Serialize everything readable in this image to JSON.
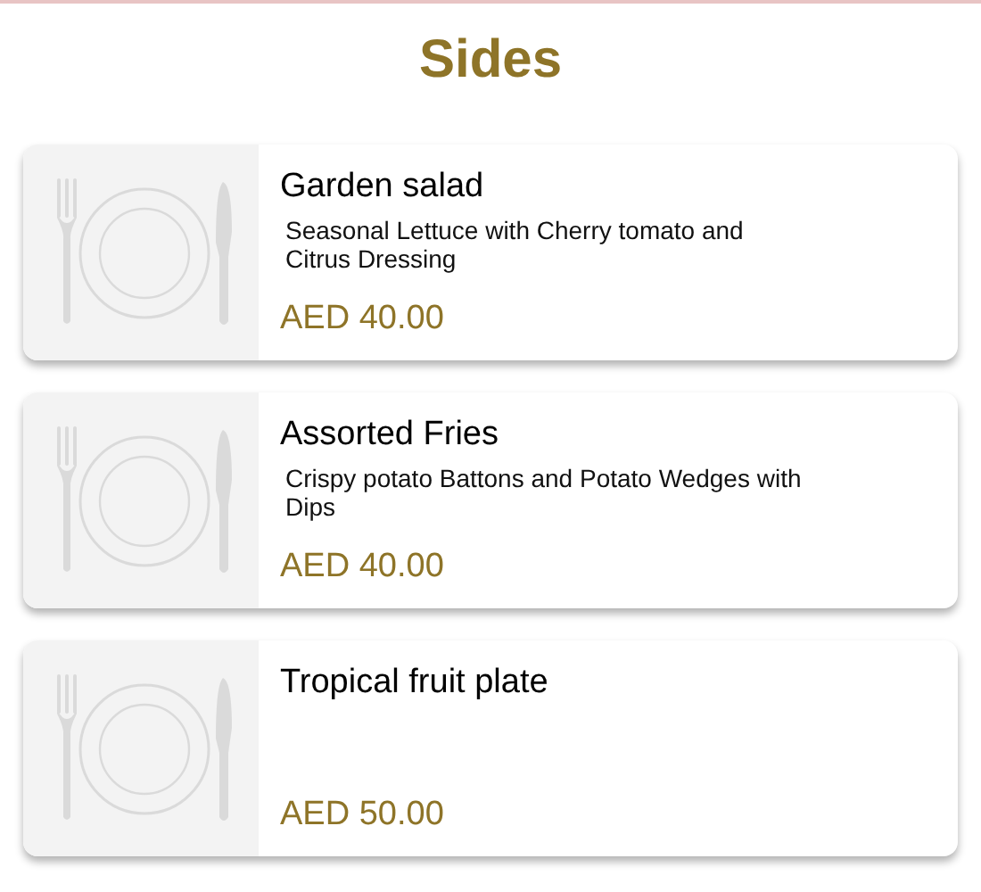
{
  "title": "Sides",
  "items": [
    {
      "name": "Garden salad",
      "description": "Seasonal Lettuce with Cherry tomato and Citrus Dressing",
      "price": "AED 40.00"
    },
    {
      "name": "Assorted Fries",
      "description": "Crispy potato Battons and Potato Wedges with Dips",
      "price": "AED 40.00"
    },
    {
      "name": "Tropical fruit plate",
      "price": "AED 50.00"
    }
  ]
}
